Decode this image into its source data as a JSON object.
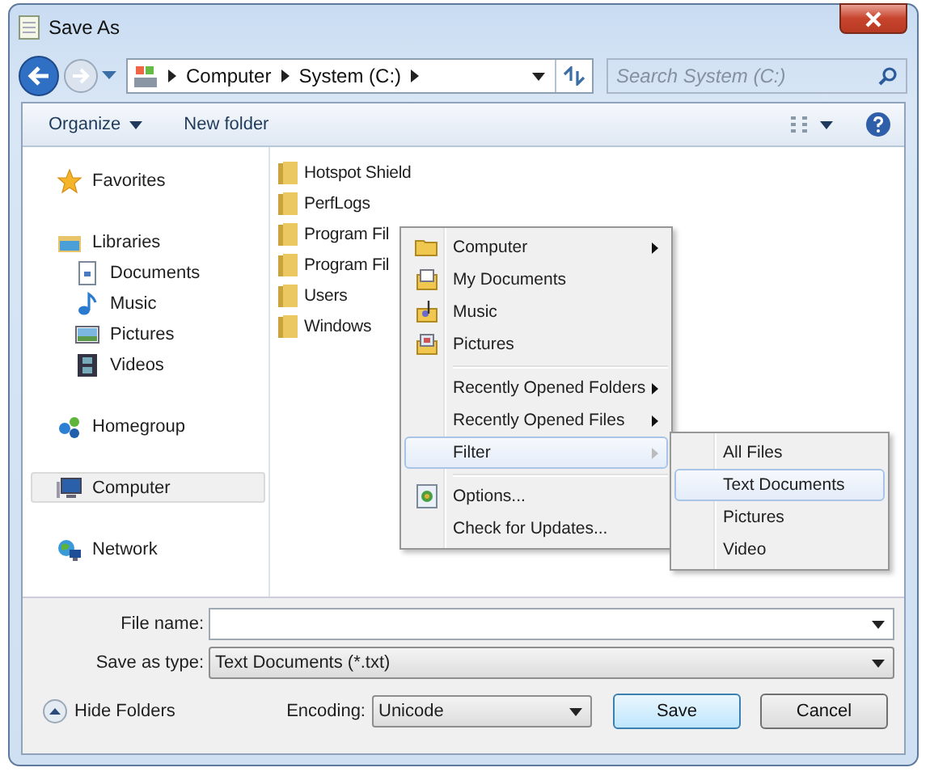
{
  "window": {
    "title": "Save As"
  },
  "address": {
    "crumbs": [
      "Computer",
      "System (C:)"
    ]
  },
  "search": {
    "placeholder": "Search System (C:)"
  },
  "toolbar": {
    "items": [
      "Organize",
      "New folder"
    ]
  },
  "sidebar": {
    "items": [
      {
        "label": "Favorites",
        "kind": "star",
        "selected": false
      },
      {
        "label": "Libraries",
        "kind": "library",
        "selected": false,
        "children": [
          {
            "label": "Documents",
            "kind": "document",
            "selected": false
          },
          {
            "label": "Music",
            "kind": "music",
            "selected": false
          },
          {
            "label": "Pictures",
            "kind": "picture",
            "selected": false
          },
          {
            "label": "Videos",
            "kind": "video",
            "selected": false
          }
        ]
      },
      {
        "label": "Homegroup",
        "kind": "homegroup",
        "selected": false
      },
      {
        "label": "Computer",
        "kind": "computer",
        "selected": true
      },
      {
        "label": "Network",
        "kind": "network",
        "selected": false
      }
    ]
  },
  "files": [
    "Hotspot Shield",
    "PerfLogs",
    "Program Fil",
    "Program Fil",
    "Users",
    "Windows"
  ],
  "context_menu": {
    "groups": [
      [
        {
          "label": "Computer",
          "kind": "folder",
          "has_submenu": true,
          "selected": false
        },
        {
          "label": "My Documents",
          "kind": "documents",
          "has_submenu": false,
          "selected": false
        },
        {
          "label": "Music",
          "kind": "music",
          "has_submenu": false,
          "selected": false
        },
        {
          "label": "Pictures",
          "kind": "pictures",
          "has_submenu": false,
          "selected": false
        }
      ],
      [
        {
          "label": "Recently Opened Folders",
          "kind": "plain",
          "has_submenu": true,
          "selected": false
        },
        {
          "label": "Recently Opened Files",
          "kind": "plain",
          "has_submenu": true,
          "selected": false
        },
        {
          "label": "Filter",
          "kind": "plain",
          "has_submenu": true,
          "selected": true
        }
      ],
      [
        {
          "label": "Options...",
          "kind": "options",
          "has_submenu": false,
          "selected": false
        },
        {
          "label": "Check for Updates...",
          "kind": "plain",
          "has_submenu": false,
          "selected": false
        }
      ]
    ],
    "submenu": [
      {
        "label": "All Files",
        "selected": false
      },
      {
        "label": "Text Documents",
        "selected": true
      },
      {
        "label": "Pictures",
        "selected": false
      },
      {
        "label": "Video",
        "selected": false
      }
    ]
  },
  "form": {
    "file_name": {
      "label": "File name:"
    },
    "save_as_type": {
      "label": "Save as type:",
      "value": "Text Documents (*.txt)"
    }
  },
  "footer": {
    "hide_folders": "Hide Folders",
    "encoding": {
      "label": "Encoding:",
      "value": "Unicode"
    },
    "buttons": [
      "Save",
      "Cancel"
    ]
  }
}
